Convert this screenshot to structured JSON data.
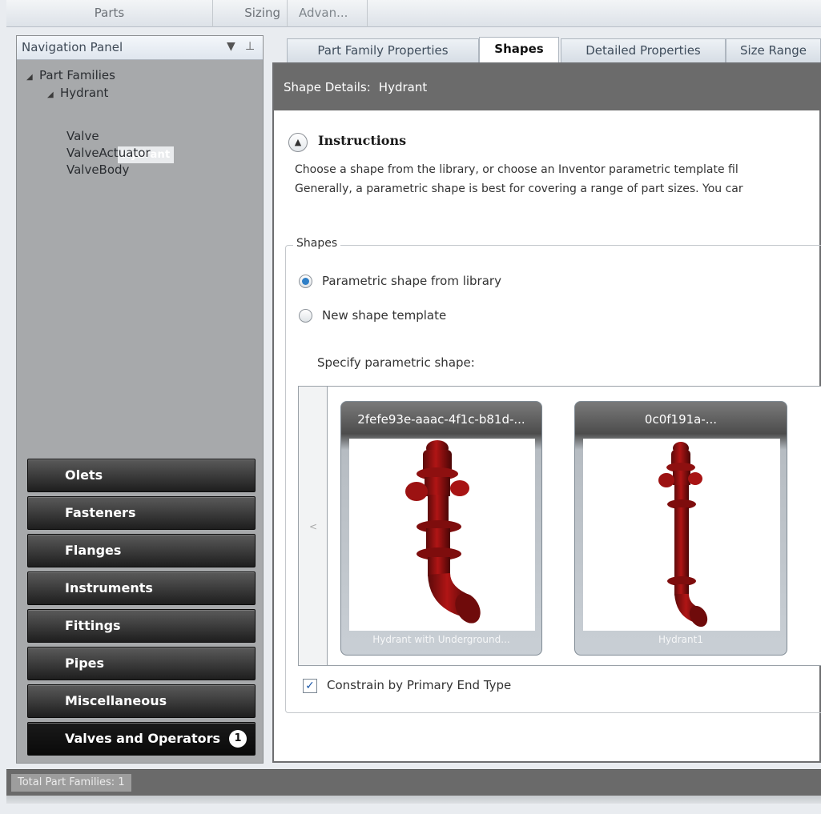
{
  "top_tabs": [
    "Parts",
    "Sizing",
    "Advan..."
  ],
  "nav": {
    "title": "Navigation Panel",
    "root": "Part Families",
    "group": "Hydrant",
    "selected": "Hydrant",
    "items": [
      "Valve",
      "ValveActuator",
      "ValveBody"
    ],
    "categories": [
      "Olets",
      "Fasteners",
      "Flanges",
      "Instruments",
      "Fittings",
      "Pipes",
      "Miscellaneous",
      "Valves and Operators"
    ],
    "active_badge": "1"
  },
  "content_tabs": [
    "Part Family Properties",
    "Shapes",
    "Detailed Properties",
    "Size Range"
  ],
  "panel": {
    "label": "Shape Details:",
    "value": "Hydrant"
  },
  "instructions": {
    "title": "Instructions",
    "line1": "Choose a shape from the library, or choose an Inventor parametric template fil",
    "line2": "Generally, a parametric shape is best for covering a range of part sizes. You car"
  },
  "shapes": {
    "legend": "Shapes",
    "option_library": "Parametric shape from library",
    "option_template": "New shape template",
    "specify_label": "Specify parametric shape:",
    "cards": [
      {
        "title": "2fefe93e-aaac-4f1c-b81d-...",
        "caption": "Hydrant with Underground..."
      },
      {
        "title": "0c0f191a-...",
        "caption": "Hydrant1"
      }
    ],
    "constrain_label": "Constrain by Primary End Type",
    "constrain_checked": true
  },
  "status": {
    "label": "Total Part Families:",
    "count": "1"
  }
}
